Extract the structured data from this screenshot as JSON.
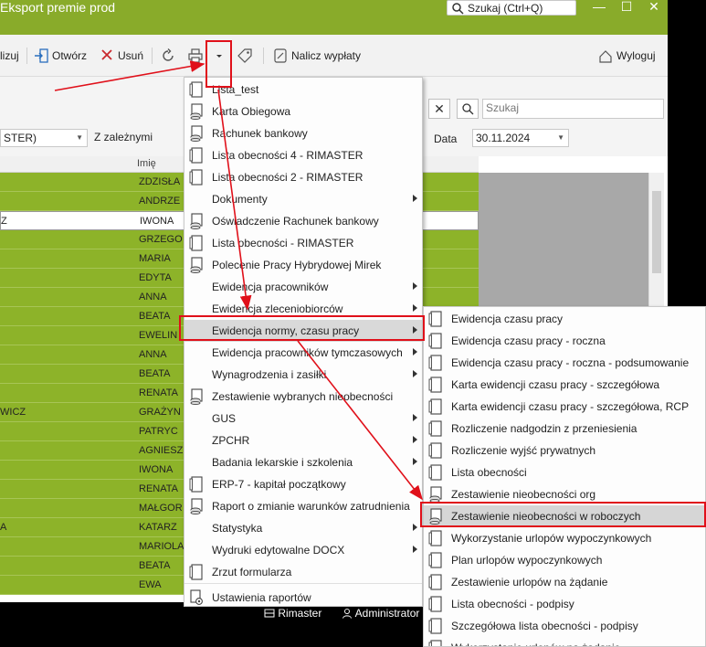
{
  "window": {
    "title": "Eksport premie prod",
    "search_text": "Szukaj (Ctrl+Q)",
    "minimize": "—",
    "maximize": "☐",
    "close": "✕"
  },
  "toolbar": {
    "partial_label": "lizuj",
    "open_label": "Otwórz",
    "delete_label": "Usuń",
    "calculate_label": "Nalicz wypłaty",
    "logout_label": "Wyloguj"
  },
  "filters": {
    "combo_value": "STER)",
    "dependents_label": "Z zależnymi",
    "search_placeholder": "Szukaj",
    "date_label": "Data",
    "date_value": "30.11.2024"
  },
  "grid": {
    "header_name": "Imię",
    "rows": [
      {
        "surname": "",
        "name": "ZDZISŁA"
      },
      {
        "surname": "",
        "name": "ANDRZE"
      },
      {
        "surname": "Z",
        "name": "IWONA"
      },
      {
        "surname": "",
        "name": "GRZEGO"
      },
      {
        "surname": "",
        "name": "MARIA"
      },
      {
        "surname": "",
        "name": "EDYTA"
      },
      {
        "surname": "",
        "name": "ANNA"
      },
      {
        "surname": "",
        "name": "BEATA"
      },
      {
        "surname": "",
        "name": "EWELIN"
      },
      {
        "surname": "",
        "name": "ANNA"
      },
      {
        "surname": "",
        "name": "BEATA"
      },
      {
        "surname": "",
        "name": "RENATA"
      },
      {
        "surname": "WICZ",
        "name": "GRAŻYN"
      },
      {
        "surname": "",
        "name": "PATRYC"
      },
      {
        "surname": "",
        "name": "AGNIESZ"
      },
      {
        "surname": "",
        "name": "IWONA"
      },
      {
        "surname": "",
        "name": "RENATA"
      },
      {
        "surname": "",
        "name": "MAŁGOR"
      },
      {
        "surname": "A",
        "name": "KATARZ"
      },
      {
        "surname": "",
        "name": "MARIOLA"
      },
      {
        "surname": "",
        "name": "BEATA"
      },
      {
        "surname": "",
        "name": "EWA"
      }
    ]
  },
  "statusbar": {
    "db_label": "Rimaster",
    "user_label": "Administrator"
  },
  "print_menu": {
    "items": [
      {
        "label": "Lista_test",
        "icon": "report-page-icon",
        "submenu": false
      },
      {
        "label": "Karta Obiegowa",
        "icon": "report-db-icon",
        "submenu": false
      },
      {
        "label": "Rachunek bankowy",
        "icon": "report-db-icon",
        "submenu": false
      },
      {
        "label": "Lista obecności 4 - RIMASTER",
        "icon": "report-page-icon",
        "submenu": false
      },
      {
        "label": "Lista obecności 2 - RIMASTER",
        "icon": "report-page-icon",
        "submenu": false
      },
      {
        "label": "Dokumenty",
        "icon": "",
        "submenu": true
      },
      {
        "label": "Oświadczenie Rachunek bankowy",
        "icon": "report-db-icon",
        "submenu": false
      },
      {
        "label": "Lista obecności - RIMASTER",
        "icon": "report-page-icon",
        "submenu": false
      },
      {
        "label": "Polecenie Pracy Hybrydowej Mirek",
        "icon": "report-db-icon",
        "submenu": false
      },
      {
        "label": "Ewidencja pracowników",
        "icon": "",
        "submenu": true
      },
      {
        "label": "Ewidencja zleceniobiorców",
        "icon": "",
        "submenu": true
      },
      {
        "label": "Ewidencja normy, czasu pracy",
        "icon": "",
        "submenu": true
      },
      {
        "label": "Ewidencja pracowników tymczasowych",
        "icon": "",
        "submenu": true
      },
      {
        "label": "Wynagrodzenia i zasiłki",
        "icon": "",
        "submenu": true
      },
      {
        "label": "Zestawienie wybranych nieobecności",
        "icon": "report-db-icon",
        "submenu": false
      },
      {
        "label": "GUS",
        "icon": "",
        "submenu": true
      },
      {
        "label": "ZPCHR",
        "icon": "",
        "submenu": true
      },
      {
        "label": "Badania lekarskie i szkolenia",
        "icon": "",
        "submenu": true
      },
      {
        "label": "ERP-7 - kapitał początkowy",
        "icon": "report-page-icon",
        "submenu": false
      },
      {
        "label": "Raport o zmianie warunków zatrudnienia",
        "icon": "report-db-icon",
        "submenu": false
      },
      {
        "label": "Statystyka",
        "icon": "",
        "submenu": true
      },
      {
        "label": "Wydruki edytowalne DOCX",
        "icon": "",
        "submenu": true
      },
      {
        "label": "Zrzut formularza",
        "icon": "report-page-icon",
        "submenu": false
      },
      {
        "label": "Ustawienia raportów",
        "icon": "report-settings-icon",
        "submenu": false
      }
    ]
  },
  "time_menu": {
    "items": [
      {
        "label": "Ewidencja czasu pracy",
        "icon": "report-page-icon"
      },
      {
        "label": "Ewidencja czasu pracy - roczna",
        "icon": "report-page-icon"
      },
      {
        "label": "Ewidencja czasu pracy - roczna - podsumowanie",
        "icon": "report-page-icon"
      },
      {
        "label": "Karta ewidencji czasu pracy - szczegółowa",
        "icon": "report-page-icon"
      },
      {
        "label": "Karta ewidencji czasu pracy - szczegółowa, RCP",
        "icon": "report-page-icon"
      },
      {
        "label": "Rozliczenie nadgodzin z przeniesienia",
        "icon": "report-page-icon"
      },
      {
        "label": "Rozliczenie wyjść prywatnych",
        "icon": "report-page-icon"
      },
      {
        "label": "Lista obecności",
        "icon": "report-page-icon"
      },
      {
        "label": "Zestawienie nieobecności org",
        "icon": "report-db-icon"
      },
      {
        "label": "Zestawienie nieobecności w roboczych",
        "icon": "report-db-icon"
      },
      {
        "label": "Wykorzystanie urlopów wypoczynkowych",
        "icon": "report-page-icon"
      },
      {
        "label": "Plan urlopów wypoczynkowych",
        "icon": "report-page-icon"
      },
      {
        "label": "Zestawienie urlopów na żądanie",
        "icon": "report-page-icon"
      },
      {
        "label": "Lista obecności - podpisy",
        "icon": "report-page-icon"
      },
      {
        "label": "Szczegółowa lista obecności - podpisy",
        "icon": "report-page-icon"
      },
      {
        "label": "Wykorzystanie urlopów na żądanie",
        "icon": "report-page-icon"
      }
    ]
  },
  "colors": {
    "accent_green": "#89ab2a",
    "row_green": "#8db329",
    "annotation_red": "#e0101a"
  }
}
